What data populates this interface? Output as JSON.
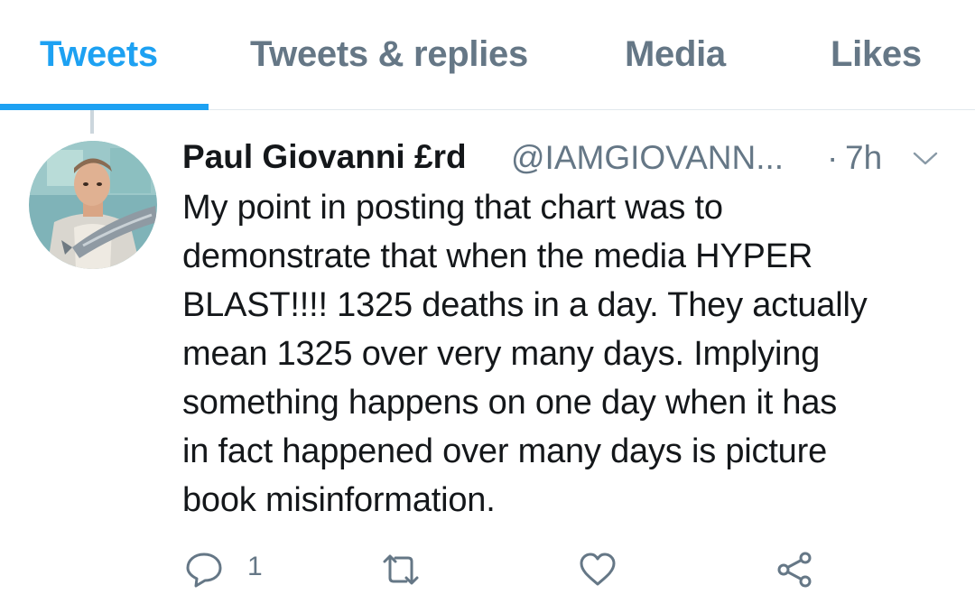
{
  "tabs": [
    {
      "label": "Tweets",
      "active": true
    },
    {
      "label": "Tweets & replies",
      "active": false
    },
    {
      "label": "Media",
      "active": false
    },
    {
      "label": "Likes",
      "active": false
    }
  ],
  "tweet": {
    "display_name": "Paul Giovanni £rd",
    "handle": "@IAMGIOVANN...",
    "separator": "·",
    "time": "7h",
    "text": "My point in posting that chart was to\ndemonstrate that when the media HYPER\nBLAST!!!! 1325 deaths in a day. They actually\nmean 1325 over very many days. Implying\nsomething happens on one day when it has\nin fact happened over many days is picture\nbook misinformation.",
    "reply_count": "1"
  },
  "icons": {
    "caret": "chevron-down-icon",
    "reply": "reply-bubble-icon",
    "retweet": "retweet-icon",
    "like": "heart-icon",
    "share": "share-icon"
  },
  "colors": {
    "accent": "#1da1f2",
    "secondary_text": "#657786",
    "primary_text": "#14171a",
    "divider": "#e1e8ed"
  }
}
